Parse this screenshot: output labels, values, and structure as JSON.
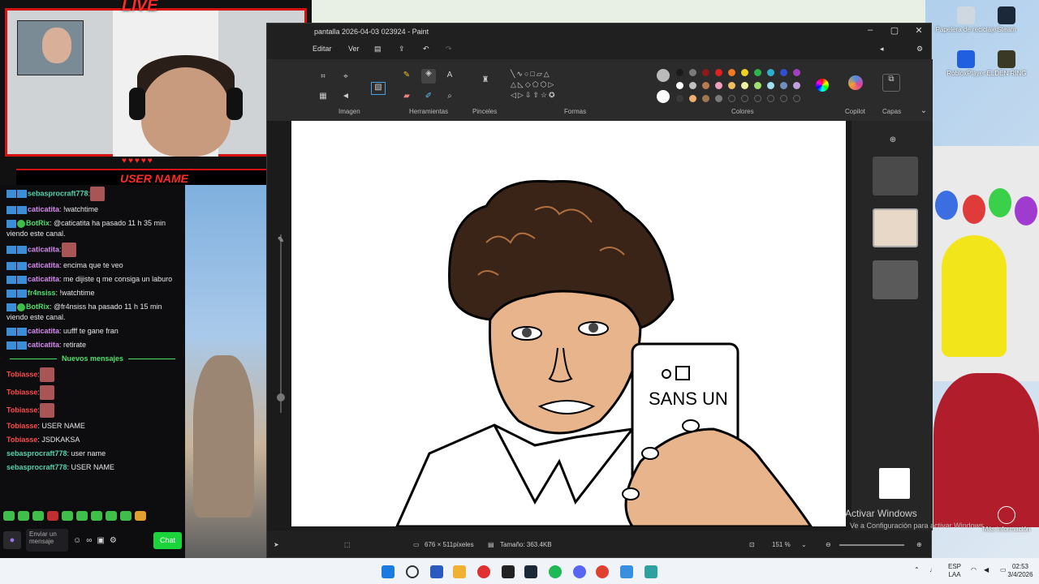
{
  "stream": {
    "live_label": "LIVE",
    "user_name_banner": "USER NAME"
  },
  "chat": {
    "messages": [
      {
        "user": "sebasprocraft778",
        "text": ":"
      },
      {
        "user": "caticatita",
        "text": ": !watchtime"
      },
      {
        "user": "BotRix",
        "text": ": @caticatita ha pasado 11 h 35 min viendo este canal."
      },
      {
        "user": "caticatita",
        "text": ":"
      },
      {
        "user": "caticatita",
        "text": ": encima que te veo"
      },
      {
        "user": "caticatita",
        "text": ": me dijiste q me consiga un laburo"
      },
      {
        "user": "fr4nsiss",
        "text": ": !watchtime"
      },
      {
        "user": "BotRix",
        "text": ": @fr4nsiss ha pasado 11 h 15 min viendo este canal."
      },
      {
        "user": "caticatita",
        "text": ": uufff te gane fran"
      },
      {
        "user": "caticatita",
        "text": ": retirate"
      }
    ],
    "new_messages_label": "Nuevos mensajes",
    "new_messages": [
      {
        "user": "Tobiasse",
        "text": ":"
      },
      {
        "user": "Tobiasse",
        "text": ":"
      },
      {
        "user": "Tobiasse",
        "text": ":"
      },
      {
        "user": "Tobiasse",
        "text": ": USER NAME"
      },
      {
        "user": "Tobiasse",
        "text": ": JSDKAKSA"
      },
      {
        "user": "sebasprocraft778",
        "text": ": user name"
      },
      {
        "user": "sebasprocraft778",
        "text": ": USER NAME"
      }
    ],
    "input_placeholder": "Enviar un mensaje",
    "send_button": "Chat"
  },
  "paint": {
    "window_title": "pantalla 2026-04-03 023924 - Paint",
    "menu": {
      "edit": "Editar",
      "view": "Ver"
    },
    "ribbon_groups": {
      "image": "Imagen",
      "tools": "Herramientas",
      "brushes": "Pinceles",
      "shapes": "Formas",
      "colors": "Colores",
      "copilot": "Copilot",
      "layers": "Capas"
    },
    "canvas_text": "SANS UN",
    "status": {
      "dimensions": "676 × 511píxeles",
      "size": "Tamaño: 363.4KB",
      "zoom": "151 %"
    },
    "palette_row1": [
      "#1a1a1a",
      "#7a7a7a",
      "#8b1a1a",
      "#e02020",
      "#f07a20",
      "#f0d020",
      "#2fb34a",
      "#30b0d0",
      "#3050d0",
      "#a040c0"
    ],
    "palette_row2": [
      "#ffffff",
      "#c0c0c0",
      "#b87a50",
      "#f0a0c0",
      "#f0c060",
      "#f0f0a0",
      "#a0e070",
      "#a0e0f0",
      "#7090c0",
      "#c0a0e0"
    ],
    "palette_row3": [
      "#3a3a3a",
      "#f0b070",
      "#a07850",
      "#7a7a7a"
    ]
  },
  "desktop": {
    "icons": [
      {
        "label": "Papelera de reciclaje"
      },
      {
        "label": "Steam"
      },
      {
        "label": "RobloxPlayer"
      },
      {
        "label": "ELDEN RING"
      },
      {
        "label": "Más información"
      }
    ],
    "activate_windows": "Activar Windows",
    "activate_sub": "Ve a Configuración para activar Windows."
  },
  "taskbar": {
    "lang1": "ESP",
    "lang2": "LAA",
    "time": "02:53",
    "date": "3/4/2026"
  }
}
